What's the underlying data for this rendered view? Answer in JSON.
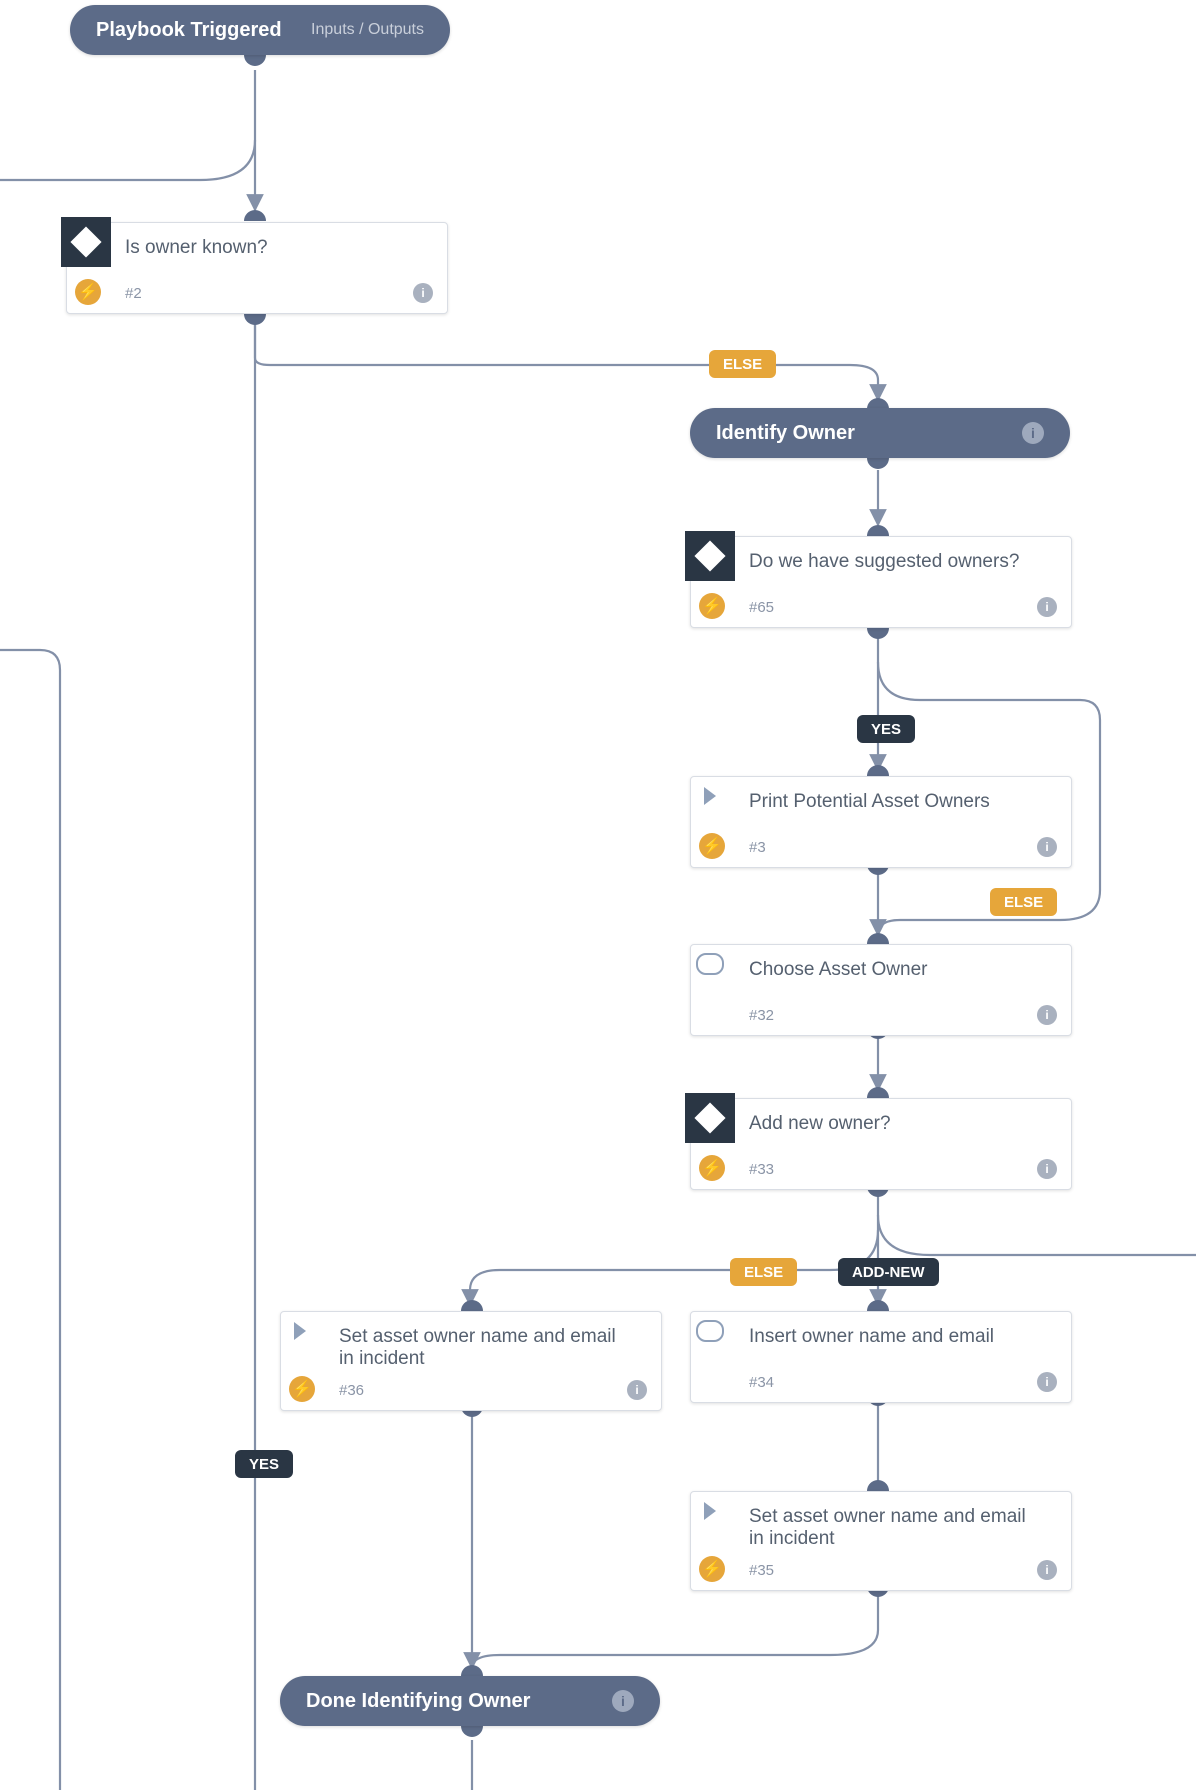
{
  "trigger": {
    "title": "Playbook Triggered",
    "sub": "Inputs / Outputs"
  },
  "n2": {
    "label": "Is owner known?",
    "num": "#2"
  },
  "identify": {
    "title": "Identify Owner"
  },
  "n65": {
    "label": "Do we have suggested owners?",
    "num": "#65"
  },
  "n3": {
    "label": "Print Potential Asset Owners",
    "num": "#3"
  },
  "n32": {
    "label": "Choose Asset Owner",
    "num": "#32"
  },
  "n33": {
    "label": "Add new owner?",
    "num": "#33"
  },
  "n36": {
    "label": "Set asset owner name and email in incident",
    "num": "#36"
  },
  "n34": {
    "label": "Insert owner name and email",
    "num": "#34"
  },
  "n35": {
    "label": "Set asset owner name and email in incident",
    "num": "#35"
  },
  "done": {
    "title": "Done Identifying Owner"
  },
  "tag_else1": "ELSE",
  "tag_yes65": "YES",
  "tag_else65": "ELSE",
  "tag_else33": "ELSE",
  "tag_addnew": "ADD-NEW",
  "tag_yes2": "YES"
}
